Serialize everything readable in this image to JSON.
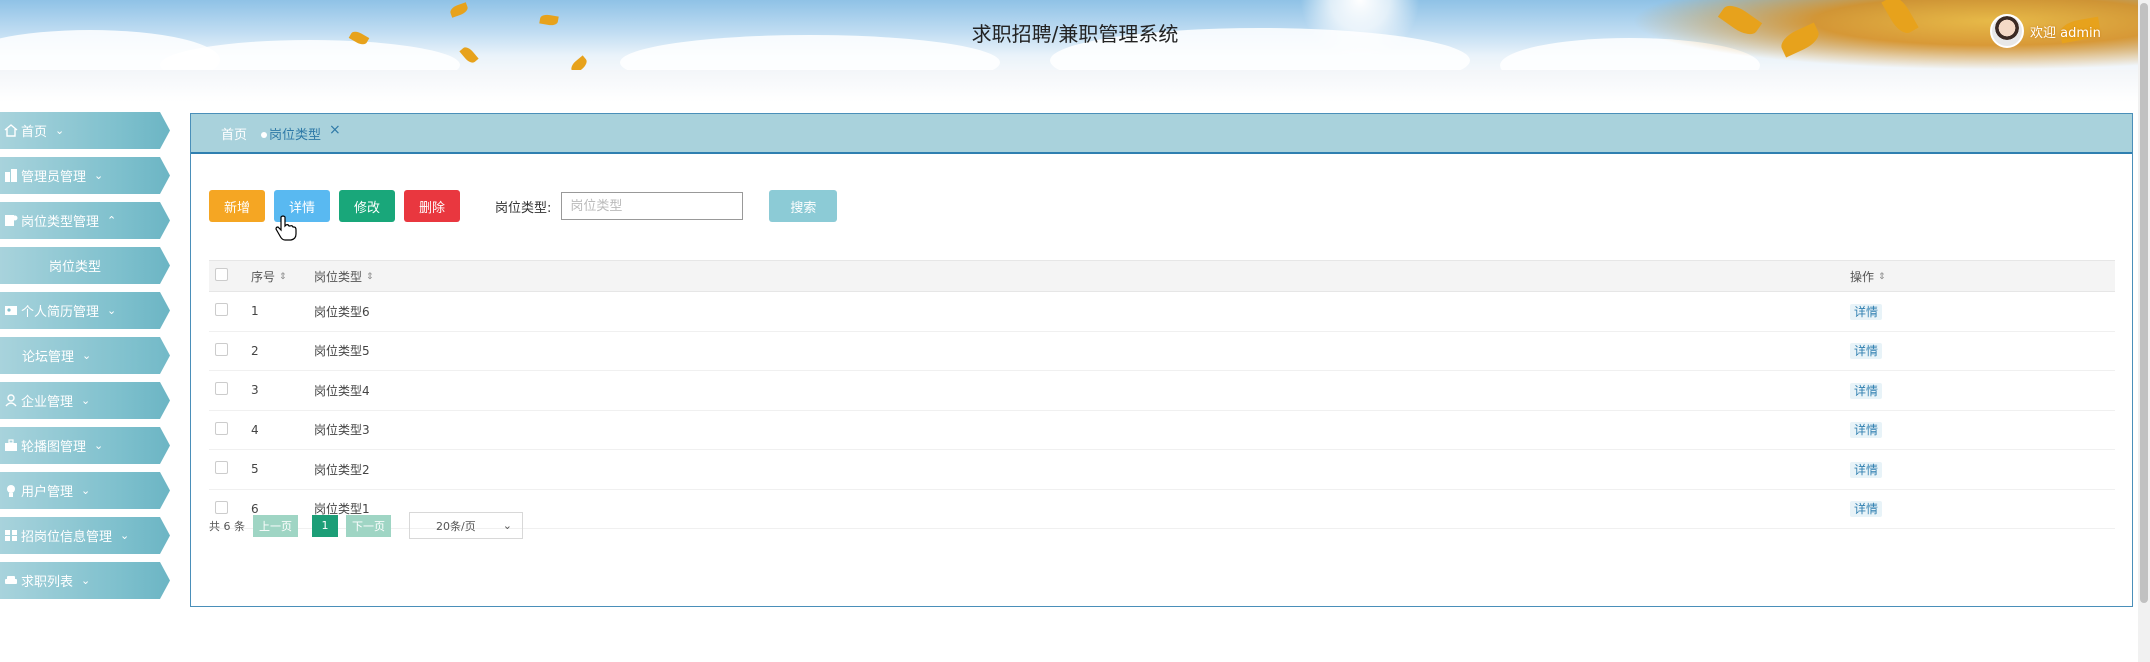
{
  "header": {
    "title": "求职招聘/兼职管理系统",
    "welcome": "欢迎 admin"
  },
  "sidebar": {
    "items": [
      {
        "label": "首页",
        "icon": "home-icon",
        "caret": "⌄"
      },
      {
        "label": "管理员管理",
        "icon": "building-icon",
        "caret": "⌄"
      },
      {
        "label": "岗位类型管理",
        "icon": "doc-user-icon",
        "caret": "⌃"
      },
      {
        "label": "岗位类型",
        "icon": "",
        "caret": ""
      },
      {
        "label": "个人简历管理",
        "icon": "id-card-icon",
        "caret": "⌄"
      },
      {
        "label": "论坛管理",
        "icon": "",
        "caret": "⌄"
      },
      {
        "label": "企业管理",
        "icon": "user-icon",
        "caret": "⌄"
      },
      {
        "label": "轮播图管理",
        "icon": "briefcase-icon",
        "caret": "⌄"
      },
      {
        "label": "用户管理",
        "icon": "person-badge-icon",
        "caret": "⌄"
      },
      {
        "label": "招岗位信息管理",
        "icon": "grid-icon",
        "caret": "⌄"
      },
      {
        "label": "求职列表",
        "icon": "sofa-icon",
        "caret": "⌄"
      }
    ]
  },
  "breadcrumb": {
    "home": "首页",
    "current": "岗位类型",
    "close": "×"
  },
  "toolbar": {
    "add": "新增",
    "detail": "详情",
    "edit": "修改",
    "delete": "删除",
    "filter_label": "岗位类型:",
    "filter_placeholder": "岗位类型",
    "search": "搜索"
  },
  "table": {
    "headers": {
      "index": "序号",
      "type": "岗位类型",
      "op": "操作"
    },
    "sort_icon": "⇕",
    "rows": [
      {
        "index": "1",
        "type": "岗位类型6",
        "op": "详情"
      },
      {
        "index": "2",
        "type": "岗位类型5",
        "op": "详情"
      },
      {
        "index": "3",
        "type": "岗位类型4",
        "op": "详情"
      },
      {
        "index": "4",
        "type": "岗位类型3",
        "op": "详情"
      },
      {
        "index": "5",
        "type": "岗位类型2",
        "op": "详情"
      },
      {
        "index": "6",
        "type": "岗位类型1",
        "op": "详情"
      }
    ]
  },
  "pagination": {
    "total": "共 6 条",
    "prev": "上一页",
    "page": "1",
    "next": "下一页",
    "page_size": "20条/页",
    "chevron": "⌄"
  },
  "colors": {
    "add": "#f5a623",
    "detail": "#59b9f1",
    "edit": "#19a77a",
    "delete": "#e9373f",
    "accent": "#2f7fb0"
  }
}
